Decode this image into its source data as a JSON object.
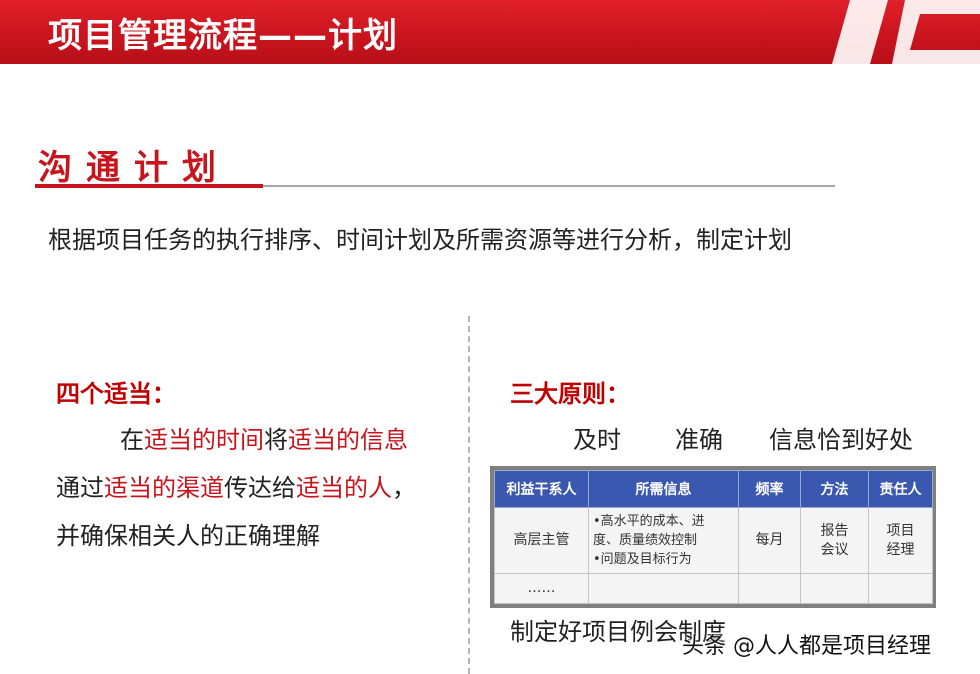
{
  "header": {
    "title": "项目管理流程——计划"
  },
  "section": {
    "title": "沟通计划",
    "intro": "根据项目任务的执行排序、时间计划及所需资源等进行分析，制定计划"
  },
  "left": {
    "heading": "四个适当：",
    "line1": {
      "a": "在",
      "b": "适当的时间",
      "c": "将",
      "d": "适当的信息"
    },
    "line2": {
      "a": "通过",
      "b": "适当的渠道",
      "c": "传达给",
      "d": "适当的人",
      "e": "，"
    },
    "line3": "并确保相关人的正确理解"
  },
  "right": {
    "heading": "三大原则：",
    "principles": [
      "及时",
      "准确",
      "信息恰到好处"
    ],
    "caption": "制定好项目例会制度"
  },
  "table": {
    "headers": [
      "利益干系人",
      "所需信息",
      "频率",
      "方法",
      "责任人"
    ],
    "row1": {
      "stakeholder": "高层主管",
      "info1": "•高水平的成本、进",
      "info2": "度、质量绩效控制",
      "info3": "•问题及目标行为",
      "frequency": "每月",
      "method1": "报告",
      "method2": "会议",
      "owner1": "项目",
      "owner2": "经理"
    },
    "row2": {
      "stakeholder": "……"
    }
  },
  "watermark": "头条 @人人都是项目经理",
  "colors": {
    "brand_red": "#c8141d",
    "table_header_blue": "#3a58b0"
  }
}
